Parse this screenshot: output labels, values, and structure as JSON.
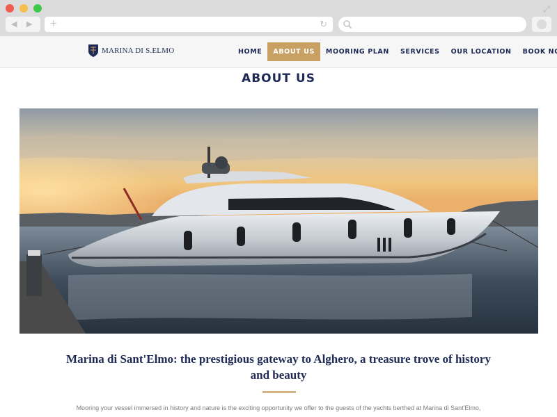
{
  "browser": {
    "back_glyph": "◀",
    "forward_glyph": "▶",
    "new_tab_glyph": "+",
    "reload_glyph": "↻",
    "expand_glyph": "⤢"
  },
  "site": {
    "logo_text": "MARINA DI S.ELMO",
    "nav": [
      "HOME",
      "ABOUT US",
      "MOORING PLAN",
      "SERVICES",
      "OUR LOCATION",
      "BOOK NOW"
    ],
    "active_nav": "ABOUT US"
  },
  "page": {
    "title": "ABOUT US",
    "headline": "Marina di Sant'Elmo: the prestigious gateway to Alghero, a treasure trove of history and beauty",
    "intro": "Mooring your vessel immersed in history and nature is the exciting opportunity we offer to the guests of the yachts berthed at Marina di Sant'Elmo,"
  },
  "colors": {
    "brand_navy": "#1e2a55",
    "accent_gold": "#c9a063"
  }
}
